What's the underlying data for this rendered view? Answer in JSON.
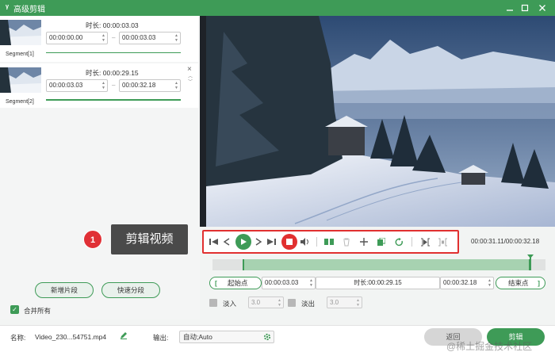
{
  "window": {
    "title": "高级剪辑",
    "logo": "ᵞ"
  },
  "segments": [
    {
      "label": "Segment[1]",
      "duration_label": "时长:",
      "duration": "00:00:03.03",
      "start": "00:00:00.00",
      "end": "00:00:03.03"
    },
    {
      "label": "Segment[2]",
      "duration_label": "时长:",
      "duration": "00:00:29.15",
      "start": "00:00:03.03",
      "end": "00:00:32.18"
    }
  ],
  "left": {
    "new_segment": "新增片段",
    "quick_split": "快速分段",
    "merge_all": "合并所有"
  },
  "annotation": {
    "number": "1",
    "text": "剪辑视频"
  },
  "player": {
    "time_readout": "00:00:31.11/00:00:32.18"
  },
  "clip": {
    "start_label": "起始点",
    "start": "00:00:03.03",
    "duration_label": "时长:",
    "duration": "00:00:29.15",
    "end": "00:00:32.18",
    "end_label": "结束点"
  },
  "fade": {
    "fade_in_label": "淡入",
    "fade_in": "3.0",
    "fade_out_label": "淡出",
    "fade_out": "3.0"
  },
  "bottom": {
    "name_label": "名称:",
    "filename": "Video_230...54751.mp4",
    "output_label": "输出:",
    "output_value": "自动;Auto",
    "return_label": "返回",
    "cut_label": "剪辑"
  },
  "watermark": "@稀土掘金技术社区",
  "colors": {
    "accent": "#3e9b57",
    "highlight": "#e13030"
  }
}
